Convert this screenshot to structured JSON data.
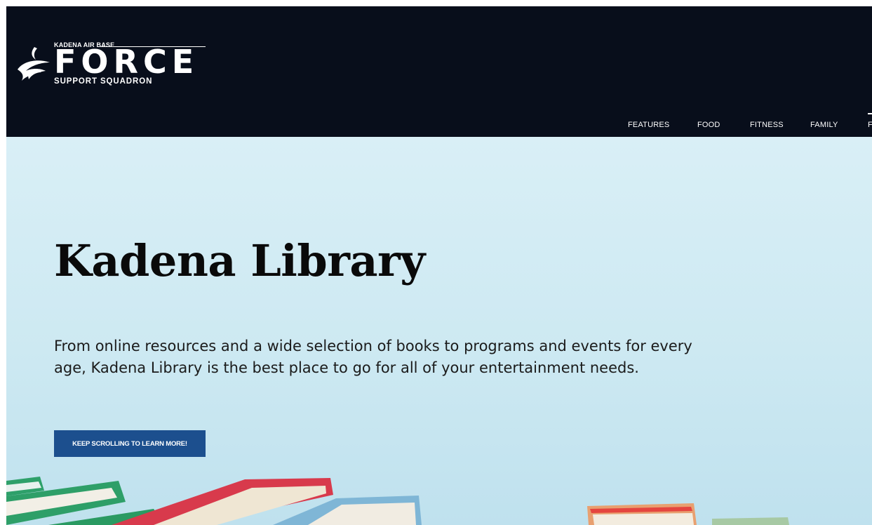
{
  "header": {
    "logo": {
      "top_text": "KADENA AIR BASE",
      "main_text": "FORCE",
      "sub_text": "SUPPORT SQUADRON"
    },
    "nav": {
      "items": [
        {
          "label": "FEATURES"
        },
        {
          "label": "FOOD"
        },
        {
          "label": "FITNESS"
        },
        {
          "label": "FAMILY"
        }
      ],
      "truncated_char": "F"
    }
  },
  "hero": {
    "title": "Kadena Library",
    "description": "From online resources and a wide selection of books to programs and events for every age, Kadena Library is the best place to go for all of your entertainment needs.",
    "cta_label": "KEEP SCROLLING TO LEARN MORE!"
  },
  "colors": {
    "header_bg": "#080e1b",
    "hero_bg": "#d3ecf4",
    "cta_bg": "#1c4f8e",
    "book_green": "#2ea06a",
    "book_red": "#d83a4c",
    "book_blue": "#7fb6d6",
    "book_orange": "#e8a070"
  }
}
